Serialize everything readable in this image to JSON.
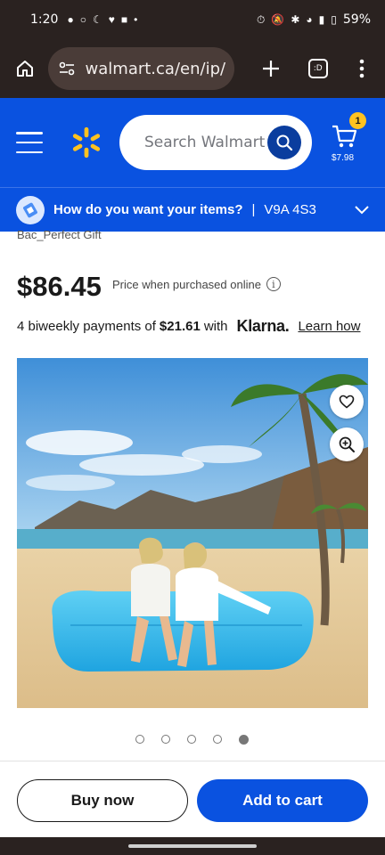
{
  "status_bar": {
    "time": "1:20",
    "battery": "59%"
  },
  "browser": {
    "url": "walmart.ca/en/ip/",
    "tabs_label": ":D"
  },
  "header": {
    "search_placeholder": "Search Walmart",
    "cart_count": "1",
    "cart_total": "$7.98",
    "brand_color": "#0a52e0",
    "spark_color": "#ffc220"
  },
  "delivery": {
    "prompt": "How do you want your items?",
    "separator": "|",
    "postal_code": "V9A 4S3"
  },
  "product": {
    "title_fragment": "Bac_Perfect Gift",
    "price": "$86.45",
    "price_note": "Price when purchased online",
    "installment_prefix": "4 biweekly payments of",
    "installment_amount": "$21.61",
    "installment_with": "with",
    "klarna": "Klarna.",
    "learn_how": "Learn how",
    "image_count": 5,
    "active_image": 5
  },
  "actions": {
    "buy_now": "Buy now",
    "add_to_cart": "Add to cart"
  }
}
